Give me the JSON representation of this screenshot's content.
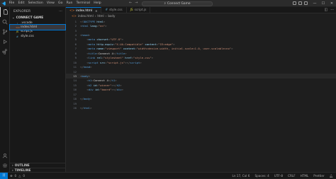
{
  "titlebar": {
    "menu": [
      "File",
      "Edit",
      "Selection",
      "View",
      "Go",
      "Run",
      "Terminal",
      "Help"
    ],
    "search_text": "Connect Game"
  },
  "sidebar": {
    "header": "EXPLORER",
    "folder": "CONNECT GAME",
    "files": [
      {
        "icon": "{}",
        "name": ".vscode"
      },
      {
        "icon": "<>",
        "name": "index.html"
      },
      {
        "icon": "JS",
        "name": "script.js"
      },
      {
        "icon": "#",
        "name": "style.css"
      }
    ],
    "outline_label": "OUTLINE",
    "timeline_label": "TIMELINE"
  },
  "editor": {
    "tabs": [
      {
        "name": "index.html",
        "active": true
      },
      {
        "name": "style.css",
        "active": false
      },
      {
        "name": "script.js",
        "active": false
      }
    ],
    "breadcrumb": [
      "index.html",
      "html",
      "body"
    ],
    "current_line": 13,
    "lines": [
      {
        "n": "1",
        "segs": [
          [
            "t-punc",
            "<!"
          ],
          [
            "t-tag",
            "DOCTYPE"
          ],
          [
            "t-attr",
            " html"
          ],
          [
            "t-punc",
            ">"
          ]
        ]
      },
      {
        "n": "2",
        "segs": [
          [
            "t-punc",
            "<"
          ],
          [
            "t-tag",
            "html"
          ],
          [
            "t-attr",
            " lang"
          ],
          [
            "t-punc",
            "="
          ],
          [
            "t-str",
            "\"en\""
          ],
          [
            "t-punc",
            ">"
          ]
        ]
      },
      {
        "n": "3",
        "segs": []
      },
      {
        "n": "4",
        "segs": [
          [
            "t-punc",
            "<"
          ],
          [
            "t-tag",
            "head"
          ],
          [
            "t-punc",
            ">"
          ]
        ]
      },
      {
        "n": "5",
        "segs": [
          [
            "t-text",
            "    "
          ],
          [
            "t-punc",
            "<"
          ],
          [
            "t-tag",
            "meta"
          ],
          [
            "t-attr",
            " charset"
          ],
          [
            "t-punc",
            "="
          ],
          [
            "t-str",
            "\"UTF-8\""
          ],
          [
            "t-punc",
            ">"
          ]
        ]
      },
      {
        "n": "6",
        "segs": [
          [
            "t-text",
            "    "
          ],
          [
            "t-punc",
            "<"
          ],
          [
            "t-tag",
            "meta"
          ],
          [
            "t-attr",
            " http-equiv"
          ],
          [
            "t-punc",
            "="
          ],
          [
            "t-str",
            "\"X-UA-Compatible\""
          ],
          [
            "t-attr",
            " content"
          ],
          [
            "t-punc",
            "="
          ],
          [
            "t-str",
            "\"IE=edge\""
          ],
          [
            "t-punc",
            ">"
          ]
        ]
      },
      {
        "n": "7",
        "segs": [
          [
            "t-text",
            "    "
          ],
          [
            "t-punc",
            "<"
          ],
          [
            "t-tag",
            "meta"
          ],
          [
            "t-attr",
            " name"
          ],
          [
            "t-punc",
            "="
          ],
          [
            "t-str",
            "\"viewport\""
          ],
          [
            "t-attr",
            " content"
          ],
          [
            "t-punc",
            "="
          ],
          [
            "t-str",
            "\"width=device-width, initial-scale=1.0, user-scalable=no\""
          ],
          [
            "t-punc",
            ">"
          ]
        ]
      },
      {
        "n": "8",
        "segs": [
          [
            "t-text",
            "    "
          ],
          [
            "t-punc",
            "<"
          ],
          [
            "t-tag",
            "title"
          ],
          [
            "t-punc",
            ">"
          ],
          [
            "t-text",
            "Connect 4"
          ],
          [
            "t-punc",
            "</"
          ],
          [
            "t-tag",
            "title"
          ],
          [
            "t-punc",
            ">"
          ]
        ]
      },
      {
        "n": "9",
        "segs": [
          [
            "t-text",
            "    "
          ],
          [
            "t-punc",
            "<"
          ],
          [
            "t-tag",
            "link"
          ],
          [
            "t-attr",
            " rel"
          ],
          [
            "t-punc",
            "="
          ],
          [
            "t-str",
            "\"stylesheet\""
          ],
          [
            "t-attr",
            " href"
          ],
          [
            "t-punc",
            "="
          ],
          [
            "t-str",
            "\"style.css\""
          ],
          [
            "t-punc",
            ">"
          ]
        ]
      },
      {
        "n": "10",
        "segs": [
          [
            "t-text",
            "    "
          ],
          [
            "t-punc",
            "<"
          ],
          [
            "t-tag",
            "script"
          ],
          [
            "t-attr",
            " src"
          ],
          [
            "t-punc",
            "="
          ],
          [
            "t-str",
            "\"script.js\""
          ],
          [
            "t-punc",
            "></"
          ],
          [
            "t-tag",
            "script"
          ],
          [
            "t-punc",
            ">"
          ]
        ]
      },
      {
        "n": "11",
        "segs": [
          [
            "t-punc",
            "</"
          ],
          [
            "t-tag",
            "head"
          ],
          [
            "t-punc",
            ">"
          ]
        ]
      },
      {
        "n": "12",
        "segs": []
      },
      {
        "n": "13",
        "segs": [
          [
            "t-punc",
            "<"
          ],
          [
            "t-tag",
            "body"
          ],
          [
            "t-punc",
            ">"
          ]
        ]
      },
      {
        "n": "14",
        "segs": [
          [
            "t-text",
            "    "
          ],
          [
            "t-punc",
            "<"
          ],
          [
            "t-tag",
            "h1"
          ],
          [
            "t-punc",
            ">"
          ],
          [
            "t-text",
            "Connect 4"
          ],
          [
            "t-punc",
            "</"
          ],
          [
            "t-tag",
            "h1"
          ],
          [
            "t-punc",
            ">"
          ]
        ]
      },
      {
        "n": "15",
        "segs": [
          [
            "t-text",
            "    "
          ],
          [
            "t-punc",
            "<"
          ],
          [
            "t-tag",
            "h2"
          ],
          [
            "t-attr",
            " id"
          ],
          [
            "t-punc",
            "="
          ],
          [
            "t-str",
            "\"winner\""
          ],
          [
            "t-punc",
            "></"
          ],
          [
            "t-tag",
            "h2"
          ],
          [
            "t-punc",
            ">"
          ]
        ]
      },
      {
        "n": "16",
        "segs": [
          [
            "t-text",
            "    "
          ],
          [
            "t-punc",
            "<"
          ],
          [
            "t-tag",
            "div"
          ],
          [
            "t-attr",
            " id"
          ],
          [
            "t-punc",
            "="
          ],
          [
            "t-str",
            "\"board\""
          ],
          [
            "t-punc",
            "></"
          ],
          [
            "t-tag",
            "div"
          ],
          [
            "t-punc",
            ">"
          ]
        ]
      },
      {
        "n": "17",
        "segs": []
      },
      {
        "n": "18",
        "segs": [
          [
            "t-punc",
            "</"
          ],
          [
            "t-tag",
            "body"
          ],
          [
            "t-punc",
            ">"
          ]
        ]
      },
      {
        "n": "19",
        "segs": []
      },
      {
        "n": "20",
        "segs": [
          [
            "t-punc",
            "</"
          ],
          [
            "t-tag",
            "html"
          ],
          [
            "t-punc",
            ">"
          ]
        ]
      }
    ]
  },
  "statusbar": {
    "errors": "0",
    "warnings": "0",
    "position": "Ln 17, Col 6",
    "spaces": "Spaces: 4",
    "encoding": "UTF-8",
    "eol": "CRLF",
    "language": "HTML",
    "prettier": "Prettier"
  },
  "colors": {
    "accent": "#0078d4",
    "background": "#1e1e1e",
    "sidebar": "#181818"
  }
}
